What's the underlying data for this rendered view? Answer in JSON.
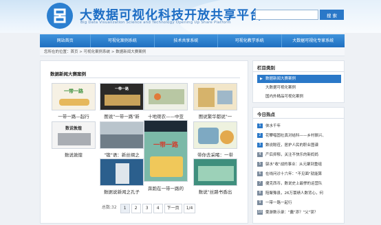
{
  "header": {
    "title": "大数据可视化科技开放共享平台",
    "subtitle": "Big Data Visualization Science and Technology Opening Up  Share Platform",
    "search_placeholder": "",
    "search_button": "搜 索"
  },
  "nav": [
    "网站首页",
    "可视化案例系统",
    "技术共享系统",
    "可视化教学系统",
    "大数据可视化专家系统"
  ],
  "breadcrumb": "您所在的位置：首页 > 可视化案例系统 > 数据新闻大赛案例",
  "main": {
    "title": "数据新闻大赛案例",
    "cards": [
      {
        "caption": "一带一路—起行",
        "thumb_text": "一带一路"
      },
      {
        "caption": "图说\"一带一路\"新",
        "thumb_text": "一带一路"
      },
      {
        "caption": "十地观农——中亚",
        "thumb_text": ""
      },
      {
        "caption": "图说繁华都说\"一",
        "thumb_text": ""
      },
      {
        "caption": "数说敦煌",
        "thumb_text": "数说敦煌"
      },
      {
        "caption": "\"锻\"语：新丝绸之",
        "thumb_text": ""
      },
      {
        "caption": "奔跑在一带一路的",
        "thumb_text": "一带一路"
      },
      {
        "caption": "带你去采睹：一带",
        "thumb_text": ""
      },
      {
        "caption": "数据说新闻之孔子",
        "thumb_text": ""
      },
      {
        "caption": "数说\"丝路书香出",
        "thumb_text": ""
      }
    ],
    "pager": {
      "total": "总数:32",
      "pages": [
        "1",
        "2",
        "3",
        "4"
      ],
      "next": "下一页",
      "count": "1/4"
    }
  },
  "sidebar": {
    "cat_title": "栏目类别",
    "categories": [
      "数据新闻大赛案例",
      "大数据可视化案例",
      "国内外精品可视化案例"
    ],
    "hot_title": "今日热点",
    "hot": [
      "侠水千年",
      "花攀唱固社真对结科——乡村振兴、",
      "数说聪莅，居护人民的职业图谱",
      "产后抑郁，关注不快乐的新妈妈",
      "驿水\"收\"战的事业：从元聚到重组",
      "在线问诊十六年：\"不见面\"就能算",
      "捷克西币，数说史上最惨的运营队",
      "陪聚豫县，26万寰绩人数背心，何",
      "一带一路一起行",
      "雯游数示录：\"蠢\"添？\"父\"误？"
    ]
  },
  "colors": {
    "brand": "#1d6dc4",
    "nav": "#2a78c8"
  }
}
